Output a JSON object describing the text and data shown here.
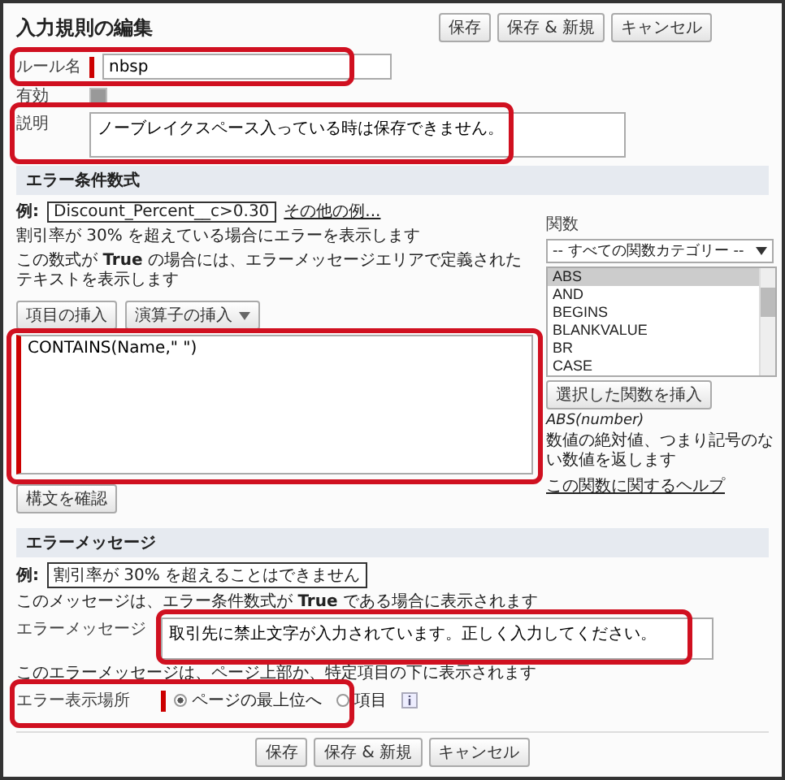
{
  "header": {
    "title": "入力規則の編集",
    "buttons": [
      "保存",
      "保存 & 新規",
      "キャンセル"
    ]
  },
  "rule_name": {
    "label": "ルール名",
    "value": "nbsp"
  },
  "active": {
    "label": "有効",
    "checked": true
  },
  "description": {
    "label": "説明",
    "value": "ノーブレイクスペース入っている時は保存できません。"
  },
  "formula_section": {
    "title": "エラー条件数式",
    "example_label": "例:",
    "example": "Discount_Percent__c>0.30",
    "more_examples_link": "その他の例...",
    "example_note": "割引率が 30% を超えている場合にエラーを表示します",
    "note": "この数式が **True** の場合には、エラーメッセージエリアで定義されたテキストを表示します",
    "insert_field_button": "項目の挿入",
    "insert_operator_button": "演算子の挿入",
    "formula": "CONTAINS(Name,\" \")",
    "check_syntax_button": "構文を確認"
  },
  "functions": {
    "label": "関数",
    "category": "-- すべての関数カテゴリー --",
    "items": [
      {
        "label": "ABS",
        "selected": true
      },
      {
        "label": "AND",
        "selected": false
      },
      {
        "label": "BEGINS",
        "selected": false
      },
      {
        "label": "BLANKVALUE",
        "selected": false
      },
      {
        "label": "BR",
        "selected": false
      },
      {
        "label": "CASE",
        "selected": false
      }
    ],
    "insert_button": "選択した関数を挿入",
    "signature": "ABS(number)",
    "description": "数値の絶対値、つまり記号のない数値を返します",
    "help_link": "この関数に関するヘルプ"
  },
  "message_section": {
    "title": "エラーメッセージ",
    "example_label": "例:",
    "example": "割引率が 30% を超えることはできません",
    "note": "このメッセージは、エラー条件数式が **True** である場合に表示されます",
    "message_label": "エラーメッセージ",
    "message": "取引先に禁止文字が入力されています。正しく入力してください。",
    "location_note": "このエラーメッセージは、ページ上部か、特定項目の下に表示されます",
    "location_label": "エラー表示場所",
    "location_options": [
      {
        "label": "ページの最上位へ",
        "selected": true
      },
      {
        "label": "項目",
        "selected": false
      }
    ]
  },
  "footer": {
    "buttons": [
      "保存",
      "保存 & 新規",
      "キャンセル"
    ]
  }
}
